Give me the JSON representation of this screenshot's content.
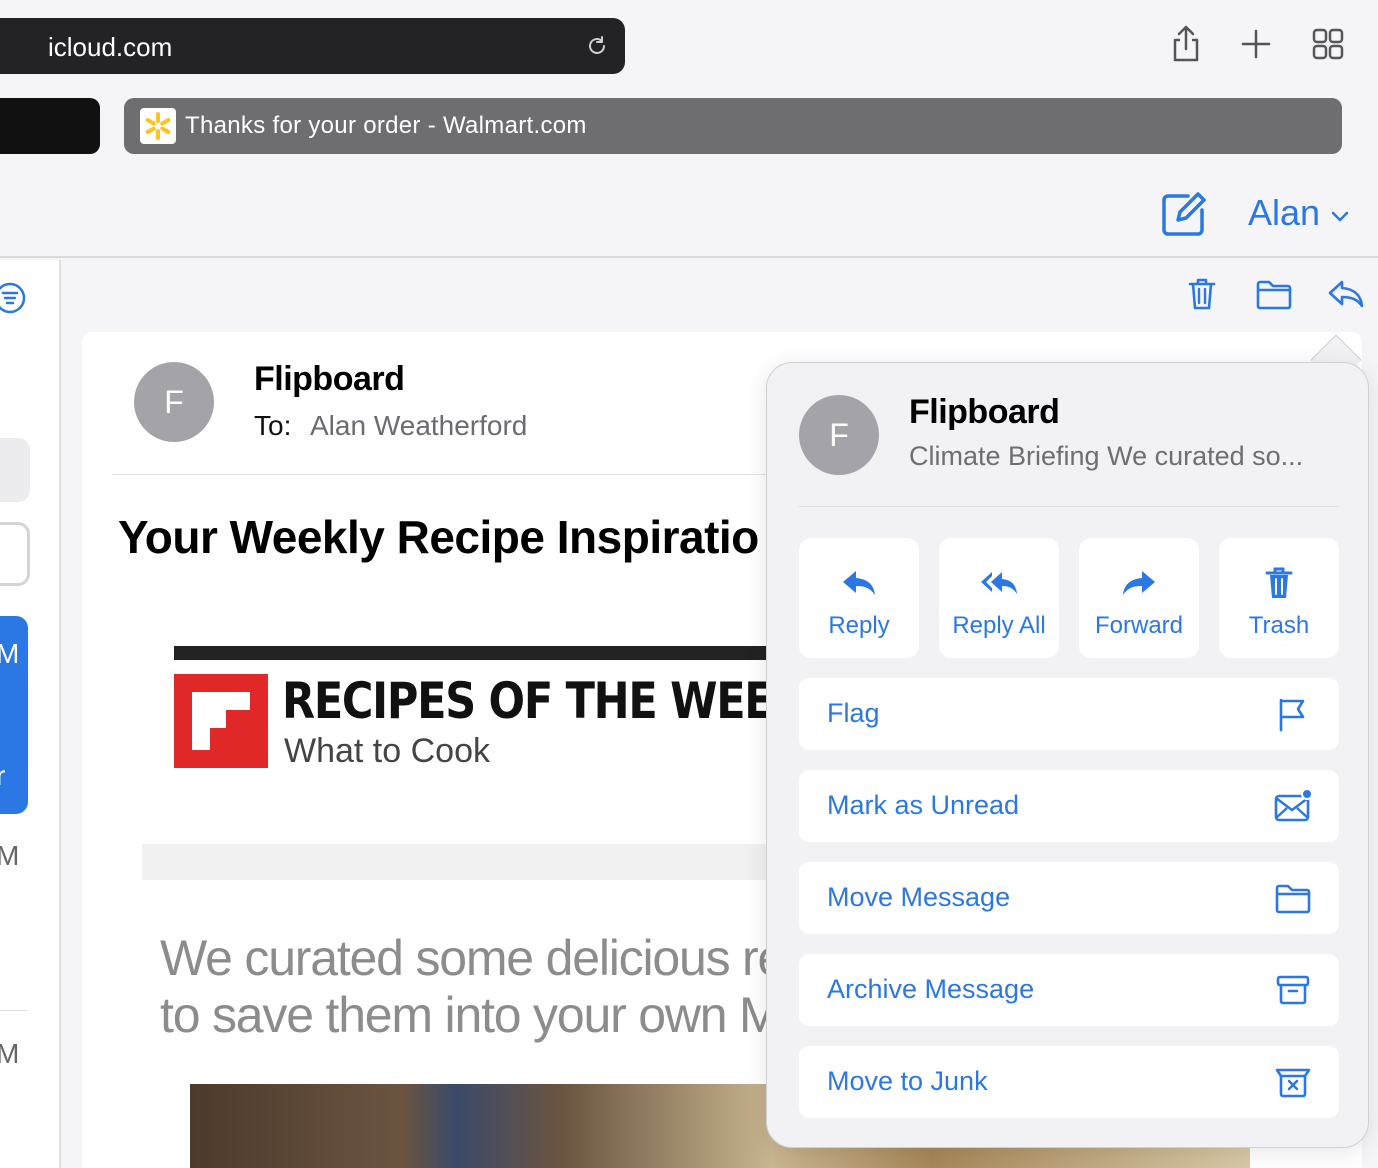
{
  "browser": {
    "url": "icloud.com",
    "tab_title": "Thanks for your order - Walmart.com"
  },
  "mail": {
    "user_name": "Alan",
    "message": {
      "avatar_letter": "F",
      "sender": "Flipboard",
      "to_label": "To:",
      "to_name": "Alan Weatherford",
      "subject": "Your Weekly Recipe Inspiratio",
      "banner_title": "RECIPES OF THE WEEK",
      "banner_subtitle": "What to Cook",
      "intro_line1": "We curated some delicious rec",
      "intro_line2": "to save them into your own Ma"
    }
  },
  "sidebar": {
    "partial_labels": [
      "M",
      "r",
      "M",
      "M"
    ]
  },
  "popover": {
    "avatar_letter": "F",
    "sender": "Flipboard",
    "preview": "Climate Briefing We curated so...",
    "quick_actions": [
      {
        "label": "Reply",
        "icon": "reply-icon"
      },
      {
        "label": "Reply All",
        "icon": "reply-all-icon"
      },
      {
        "label": "Forward",
        "icon": "forward-icon"
      },
      {
        "label": "Trash",
        "icon": "trash-icon"
      }
    ],
    "actions": [
      {
        "label": "Flag",
        "icon": "flag-icon"
      },
      {
        "label": "Mark as Unread",
        "icon": "unread-envelope-icon"
      },
      {
        "label": "Move Message",
        "icon": "folder-icon"
      },
      {
        "label": "Archive Message",
        "icon": "archive-icon"
      },
      {
        "label": "Move to Junk",
        "icon": "junk-icon"
      }
    ]
  },
  "colors": {
    "accent": "#2b78e4",
    "flipboard_red": "#e12828"
  }
}
